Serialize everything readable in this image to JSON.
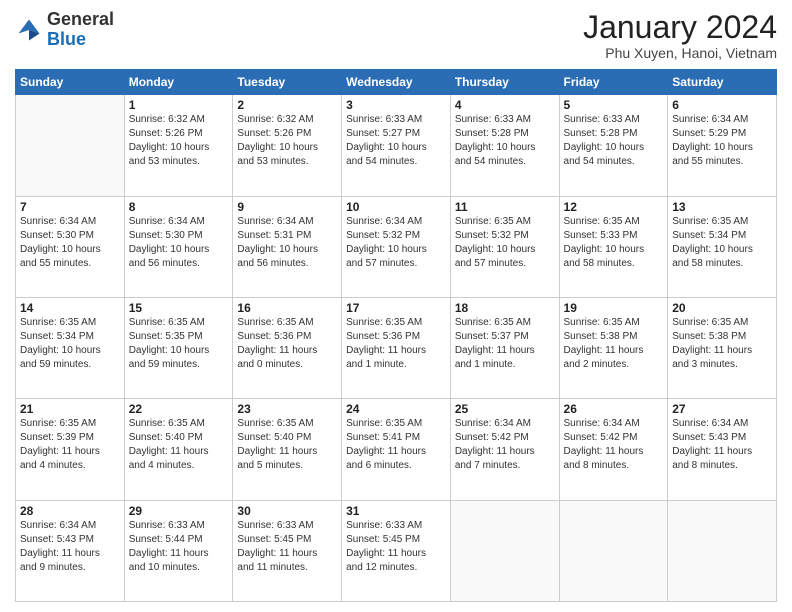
{
  "header": {
    "logo": {
      "general": "General",
      "blue": "Blue"
    },
    "title": "January 2024",
    "location": "Phu Xuyen, Hanoi, Vietnam"
  },
  "days_of_week": [
    "Sunday",
    "Monday",
    "Tuesday",
    "Wednesday",
    "Thursday",
    "Friday",
    "Saturday"
  ],
  "weeks": [
    [
      {
        "day": "",
        "lines": []
      },
      {
        "day": "1",
        "lines": [
          "Sunrise: 6:32 AM",
          "Sunset: 5:26 PM",
          "Daylight: 10 hours",
          "and 53 minutes."
        ]
      },
      {
        "day": "2",
        "lines": [
          "Sunrise: 6:32 AM",
          "Sunset: 5:26 PM",
          "Daylight: 10 hours",
          "and 53 minutes."
        ]
      },
      {
        "day": "3",
        "lines": [
          "Sunrise: 6:33 AM",
          "Sunset: 5:27 PM",
          "Daylight: 10 hours",
          "and 54 minutes."
        ]
      },
      {
        "day": "4",
        "lines": [
          "Sunrise: 6:33 AM",
          "Sunset: 5:28 PM",
          "Daylight: 10 hours",
          "and 54 minutes."
        ]
      },
      {
        "day": "5",
        "lines": [
          "Sunrise: 6:33 AM",
          "Sunset: 5:28 PM",
          "Daylight: 10 hours",
          "and 54 minutes."
        ]
      },
      {
        "day": "6",
        "lines": [
          "Sunrise: 6:34 AM",
          "Sunset: 5:29 PM",
          "Daylight: 10 hours",
          "and 55 minutes."
        ]
      }
    ],
    [
      {
        "day": "7",
        "lines": [
          "Sunrise: 6:34 AM",
          "Sunset: 5:30 PM",
          "Daylight: 10 hours",
          "and 55 minutes."
        ]
      },
      {
        "day": "8",
        "lines": [
          "Sunrise: 6:34 AM",
          "Sunset: 5:30 PM",
          "Daylight: 10 hours",
          "and 56 minutes."
        ]
      },
      {
        "day": "9",
        "lines": [
          "Sunrise: 6:34 AM",
          "Sunset: 5:31 PM",
          "Daylight: 10 hours",
          "and 56 minutes."
        ]
      },
      {
        "day": "10",
        "lines": [
          "Sunrise: 6:34 AM",
          "Sunset: 5:32 PM",
          "Daylight: 10 hours",
          "and 57 minutes."
        ]
      },
      {
        "day": "11",
        "lines": [
          "Sunrise: 6:35 AM",
          "Sunset: 5:32 PM",
          "Daylight: 10 hours",
          "and 57 minutes."
        ]
      },
      {
        "day": "12",
        "lines": [
          "Sunrise: 6:35 AM",
          "Sunset: 5:33 PM",
          "Daylight: 10 hours",
          "and 58 minutes."
        ]
      },
      {
        "day": "13",
        "lines": [
          "Sunrise: 6:35 AM",
          "Sunset: 5:34 PM",
          "Daylight: 10 hours",
          "and 58 minutes."
        ]
      }
    ],
    [
      {
        "day": "14",
        "lines": [
          "Sunrise: 6:35 AM",
          "Sunset: 5:34 PM",
          "Daylight: 10 hours",
          "and 59 minutes."
        ]
      },
      {
        "day": "15",
        "lines": [
          "Sunrise: 6:35 AM",
          "Sunset: 5:35 PM",
          "Daylight: 10 hours",
          "and 59 minutes."
        ]
      },
      {
        "day": "16",
        "lines": [
          "Sunrise: 6:35 AM",
          "Sunset: 5:36 PM",
          "Daylight: 11 hours",
          "and 0 minutes."
        ]
      },
      {
        "day": "17",
        "lines": [
          "Sunrise: 6:35 AM",
          "Sunset: 5:36 PM",
          "Daylight: 11 hours",
          "and 1 minute."
        ]
      },
      {
        "day": "18",
        "lines": [
          "Sunrise: 6:35 AM",
          "Sunset: 5:37 PM",
          "Daylight: 11 hours",
          "and 1 minute."
        ]
      },
      {
        "day": "19",
        "lines": [
          "Sunrise: 6:35 AM",
          "Sunset: 5:38 PM",
          "Daylight: 11 hours",
          "and 2 minutes."
        ]
      },
      {
        "day": "20",
        "lines": [
          "Sunrise: 6:35 AM",
          "Sunset: 5:38 PM",
          "Daylight: 11 hours",
          "and 3 minutes."
        ]
      }
    ],
    [
      {
        "day": "21",
        "lines": [
          "Sunrise: 6:35 AM",
          "Sunset: 5:39 PM",
          "Daylight: 11 hours",
          "and 4 minutes."
        ]
      },
      {
        "day": "22",
        "lines": [
          "Sunrise: 6:35 AM",
          "Sunset: 5:40 PM",
          "Daylight: 11 hours",
          "and 4 minutes."
        ]
      },
      {
        "day": "23",
        "lines": [
          "Sunrise: 6:35 AM",
          "Sunset: 5:40 PM",
          "Daylight: 11 hours",
          "and 5 minutes."
        ]
      },
      {
        "day": "24",
        "lines": [
          "Sunrise: 6:35 AM",
          "Sunset: 5:41 PM",
          "Daylight: 11 hours",
          "and 6 minutes."
        ]
      },
      {
        "day": "25",
        "lines": [
          "Sunrise: 6:34 AM",
          "Sunset: 5:42 PM",
          "Daylight: 11 hours",
          "and 7 minutes."
        ]
      },
      {
        "day": "26",
        "lines": [
          "Sunrise: 6:34 AM",
          "Sunset: 5:42 PM",
          "Daylight: 11 hours",
          "and 8 minutes."
        ]
      },
      {
        "day": "27",
        "lines": [
          "Sunrise: 6:34 AM",
          "Sunset: 5:43 PM",
          "Daylight: 11 hours",
          "and 8 minutes."
        ]
      }
    ],
    [
      {
        "day": "28",
        "lines": [
          "Sunrise: 6:34 AM",
          "Sunset: 5:43 PM",
          "Daylight: 11 hours",
          "and 9 minutes."
        ]
      },
      {
        "day": "29",
        "lines": [
          "Sunrise: 6:33 AM",
          "Sunset: 5:44 PM",
          "Daylight: 11 hours",
          "and 10 minutes."
        ]
      },
      {
        "day": "30",
        "lines": [
          "Sunrise: 6:33 AM",
          "Sunset: 5:45 PM",
          "Daylight: 11 hours",
          "and 11 minutes."
        ]
      },
      {
        "day": "31",
        "lines": [
          "Sunrise: 6:33 AM",
          "Sunset: 5:45 PM",
          "Daylight: 11 hours",
          "and 12 minutes."
        ]
      },
      {
        "day": "",
        "lines": []
      },
      {
        "day": "",
        "lines": []
      },
      {
        "day": "",
        "lines": []
      }
    ]
  ]
}
